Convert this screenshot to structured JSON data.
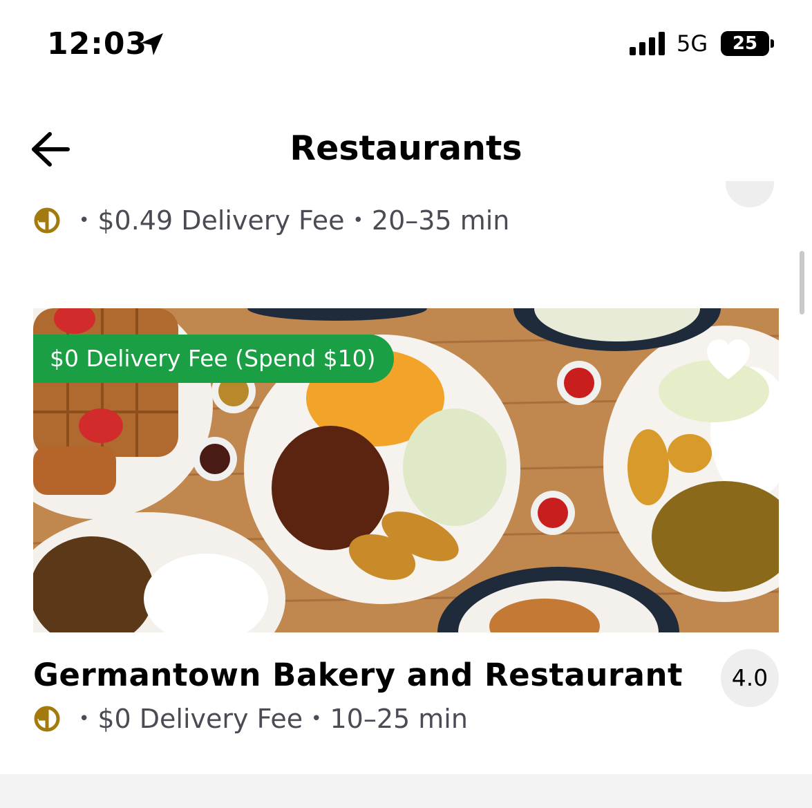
{
  "status_bar": {
    "time": "12:03",
    "network": "5G",
    "battery": "25",
    "icons": [
      "location-arrow-icon",
      "cellular-signal-icon"
    ]
  },
  "nav": {
    "title": "Restaurants",
    "back_icon": "arrow-left-icon"
  },
  "previous_card": {
    "delivery_fee": "$0.49 Delivery Fee",
    "eta": "20–35 min",
    "separator": "•"
  },
  "restaurant_card": {
    "promo": "$0 Delivery Fee (Spend $10)",
    "name": "Germantown Bakery and Restaurant",
    "rating": "4.0",
    "delivery_fee": "$0 Delivery Fee",
    "eta": "10–25 min",
    "separator": "•",
    "favorite_icon": "heart-icon",
    "member_icon": "membership-icon"
  },
  "colors": {
    "promo_green": "#1a9f45",
    "member_gold": "#a37a0d",
    "meta_text": "#4b4b56",
    "rating_bg": "#eeeeee"
  }
}
